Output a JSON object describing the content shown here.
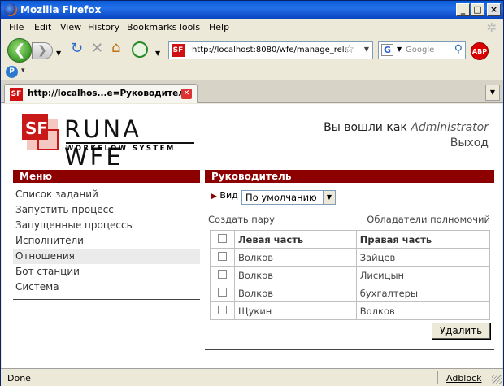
{
  "window": {
    "title": "Mozilla Firefox",
    "min_label": "_",
    "max_label": "□",
    "close_label": "×"
  },
  "menubar": {
    "items": [
      "File",
      "Edit",
      "View",
      "History",
      "Bookmarks",
      "Tools",
      "Help"
    ]
  },
  "navbar": {
    "back_icon": "back-arrow-icon",
    "forward_icon": "forward-arrow-icon",
    "url": "http://localhost:8080/wfe/manage_relat",
    "search_engine": "G",
    "search_placeholder": "Google",
    "adblock_label": "ABP"
  },
  "tabs": [
    {
      "label": "http://localhos...e=Руководитель"
    }
  ],
  "page": {
    "logo": {
      "name": "RUNA WFE",
      "subtitle": "WORKFLOW SYSTEM",
      "mark": "SF"
    },
    "user": {
      "prefix": "Вы вошли как",
      "name": "Administrator",
      "logout": "Выход"
    },
    "menu": {
      "title": "Меню",
      "items": [
        {
          "label": "Список заданий",
          "selected": false
        },
        {
          "label": "Запустить процесс",
          "selected": false
        },
        {
          "label": "Запущенные процессы",
          "selected": false
        },
        {
          "label": "Исполнители",
          "selected": false
        },
        {
          "label": "Отношения",
          "selected": true
        },
        {
          "label": "Бот станции",
          "selected": false
        },
        {
          "label": "Система",
          "selected": false
        }
      ]
    },
    "main": {
      "title": "Руководитель",
      "view_label": "Вид",
      "view_value": "По умолчанию",
      "create_pair": "Создать пару",
      "owners": "Обладатели полномочий",
      "columns": [
        "",
        "Левая часть",
        "Правая часть"
      ],
      "rows": [
        {
          "left": "Волков",
          "right": "Зайцев"
        },
        {
          "left": "Волков",
          "right": "Лисицын"
        },
        {
          "left": "Волков",
          "right": "бухгалтеры"
        },
        {
          "left": "Щукин",
          "right": "Волков"
        }
      ],
      "delete_button": "Удалить"
    }
  },
  "status": {
    "text": "Done",
    "addon": "Adblock"
  },
  "colors": {
    "section_header": "#8c0000",
    "selected_menu": "#ebebeb",
    "titlebar": "#0a5ad8"
  }
}
